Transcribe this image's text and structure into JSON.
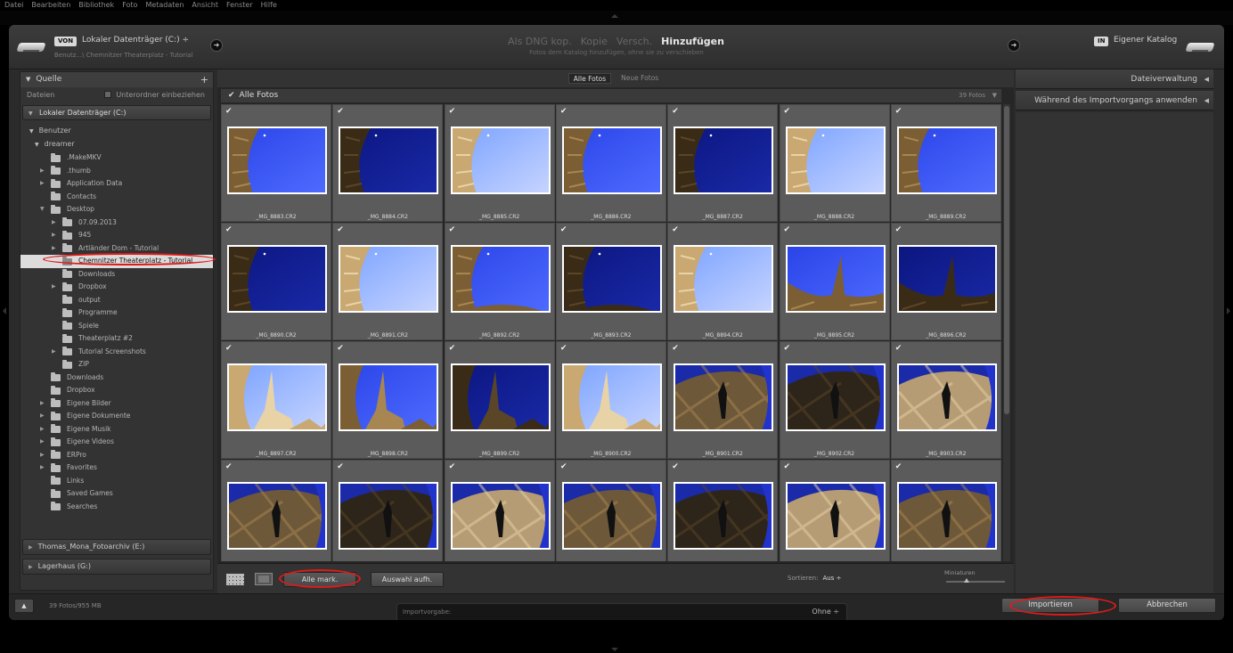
{
  "menu": [
    "Datei",
    "Bearbeiten",
    "Bibliothek",
    "Foto",
    "Metadaten",
    "Ansicht",
    "Fenster",
    "Hilfe"
  ],
  "header": {
    "source_badge": "VON",
    "source_title": "Lokaler Datenträger (C:) ÷",
    "source_path": "Benutz...\\ Chemnitzer Theaterplatz - Tutorial",
    "modes": [
      {
        "label": "Als DNG kop.",
        "active": false
      },
      {
        "label": "Kopie",
        "active": false
      },
      {
        "label": "Versch.",
        "active": false
      },
      {
        "label": "Hinzufügen",
        "active": true
      }
    ],
    "mode_subtitle": "Fotos dem Katalog hinzufügen, ohne sie zu verschieben",
    "dest_badge": "IN",
    "dest_title": "Eigener Katalog"
  },
  "left": {
    "panel_title": "Quelle",
    "files_label": "Dateien",
    "subfolders_label": "Unterordner einbeziehen",
    "volume_c": "Lokaler Datenträger (C:)",
    "benutzer": "Benutzer",
    "dreamer": "dreamer",
    "tree": [
      {
        "label": ".MakeMKV",
        "level": 1,
        "arrow": false,
        "selected": false
      },
      {
        "label": ".thumb",
        "level": 1,
        "arrow": true,
        "selected": false
      },
      {
        "label": "Application Data",
        "level": 1,
        "arrow": true,
        "selected": false
      },
      {
        "label": "Contacts",
        "level": 1,
        "arrow": false,
        "selected": false
      },
      {
        "label": "Desktop",
        "level": 1,
        "arrow": true,
        "open": true,
        "selected": false
      },
      {
        "label": "07.09.2013",
        "level": 2,
        "arrow": true,
        "selected": false
      },
      {
        "label": "945",
        "level": 2,
        "arrow": true,
        "selected": false
      },
      {
        "label": "Artländer Dom - Tutorial",
        "level": 2,
        "arrow": true,
        "selected": false
      },
      {
        "label": "Chemnitzer Theaterplatz - Tutorial",
        "level": 2,
        "arrow": false,
        "selected": true
      },
      {
        "label": "Downloads",
        "level": 2,
        "arrow": false,
        "selected": false
      },
      {
        "label": "Dropbox",
        "level": 2,
        "arrow": true,
        "selected": false
      },
      {
        "label": "output",
        "level": 2,
        "arrow": false,
        "selected": false
      },
      {
        "label": "Programme",
        "level": 2,
        "arrow": false,
        "selected": false
      },
      {
        "label": "Spiele",
        "level": 2,
        "arrow": false,
        "selected": false
      },
      {
        "label": "Theaterplatz #2",
        "level": 2,
        "arrow": false,
        "selected": false
      },
      {
        "label": "Tutorial Screenshots",
        "level": 2,
        "arrow": true,
        "selected": false
      },
      {
        "label": "ZIP",
        "level": 2,
        "arrow": false,
        "selected": false
      },
      {
        "label": "Downloads",
        "level": 1,
        "arrow": false,
        "selected": false
      },
      {
        "label": "Dropbox",
        "level": 1,
        "arrow": false,
        "selected": false
      },
      {
        "label": "Eigene Bilder",
        "level": 1,
        "arrow": true,
        "selected": false
      },
      {
        "label": "Eigene Dokumente",
        "level": 1,
        "arrow": true,
        "selected": false
      },
      {
        "label": "Eigene Musik",
        "level": 1,
        "arrow": true,
        "selected": false
      },
      {
        "label": "Eigene Videos",
        "level": 1,
        "arrow": true,
        "selected": false
      },
      {
        "label": "ERPro",
        "level": 1,
        "arrow": true,
        "selected": false
      },
      {
        "label": "Favorites",
        "level": 1,
        "arrow": true,
        "selected": false
      },
      {
        "label": "Links",
        "level": 1,
        "arrow": false,
        "selected": false
      },
      {
        "label": "Saved Games",
        "level": 1,
        "arrow": false,
        "selected": false
      },
      {
        "label": "Searches",
        "level": 1,
        "arrow": false,
        "selected": false
      }
    ],
    "volume_e": "Thomas_Mona_Fotoarchiv (E:)",
    "volume_g": "Lagerhaus (G:)"
  },
  "center": {
    "tabs": [
      {
        "label": "Alle Fotos",
        "active": true
      },
      {
        "label": "Neue Fotos",
        "active": false
      }
    ],
    "all_label": "Alle Fotos",
    "count_label": "39 Fotos",
    "photos": [
      {
        "name": "_MG_8883.CR2",
        "kind": "sky-left",
        "tone": "mid"
      },
      {
        "name": "_MG_8884.CR2",
        "kind": "sky-left",
        "tone": "dark"
      },
      {
        "name": "_MG_8885.CR2",
        "kind": "sky-left",
        "tone": "light"
      },
      {
        "name": "_MG_8886.CR2",
        "kind": "sky-left",
        "tone": "mid"
      },
      {
        "name": "_MG_8887.CR2",
        "kind": "sky-left",
        "tone": "dark"
      },
      {
        "name": "_MG_8888.CR2",
        "kind": "sky-left",
        "tone": "light"
      },
      {
        "name": "_MG_8889.CR2",
        "kind": "sky-left",
        "tone": "mid"
      },
      {
        "name": "_MG_8890.CR2",
        "kind": "sky-left",
        "tone": "dark"
      },
      {
        "name": "_MG_8891.CR2",
        "kind": "sky-left",
        "tone": "light"
      },
      {
        "name": "_MG_8892.CR2",
        "kind": "sky-bottom",
        "tone": "mid"
      },
      {
        "name": "_MG_8893.CR2",
        "kind": "sky-bottom",
        "tone": "dark"
      },
      {
        "name": "_MG_8894.CR2",
        "kind": "sky-left",
        "tone": "light"
      },
      {
        "name": "_MG_8895.CR2",
        "kind": "spire",
        "tone": "mid"
      },
      {
        "name": "_MG_8896.CR2",
        "kind": "spire",
        "tone": "dark"
      },
      {
        "name": "_MG_8897.CR2",
        "kind": "spire-left",
        "tone": "light"
      },
      {
        "name": "_MG_8898.CR2",
        "kind": "spire-left",
        "tone": "mid"
      },
      {
        "name": "_MG_8899.CR2",
        "kind": "spire-left",
        "tone": "dark"
      },
      {
        "name": "_MG_8900.CR2",
        "kind": "spire-left",
        "tone": "light"
      },
      {
        "name": "_MG_8901.CR2",
        "kind": "square",
        "tone": "mid"
      },
      {
        "name": "_MG_8902.CR2",
        "kind": "square",
        "tone": "dark"
      },
      {
        "name": "_MG_8903.CR2",
        "kind": "square",
        "tone": "light"
      },
      {
        "name": "",
        "kind": "square",
        "tone": "mid"
      },
      {
        "name": "",
        "kind": "square",
        "tone": "dark"
      },
      {
        "name": "",
        "kind": "square",
        "tone": "light"
      },
      {
        "name": "",
        "kind": "square",
        "tone": "mid"
      },
      {
        "name": "",
        "kind": "square",
        "tone": "dark"
      },
      {
        "name": "",
        "kind": "square",
        "tone": "light"
      },
      {
        "name": "",
        "kind": "square",
        "tone": "mid"
      }
    ],
    "select_all": "Alle mark.",
    "deselect": "Auswahl aufh.",
    "sort_label": "Sortieren:",
    "sort_value": "Aus ÷",
    "thumbs_label": "Miniaturen"
  },
  "right": {
    "file_handling": "Dateiverwaltung",
    "apply_during": "Während des Importvorgangs anwenden"
  },
  "footer": {
    "stats": "39 Fotos/955 MB",
    "preset_label": "Importvorgabe:",
    "preset_value": "Ohne ÷",
    "import": "Importieren",
    "cancel": "Abbrechen"
  },
  "colors": {
    "highlight": "#e01a1a",
    "sky": "#1c2fd0",
    "selection": "#dcdcdc"
  }
}
